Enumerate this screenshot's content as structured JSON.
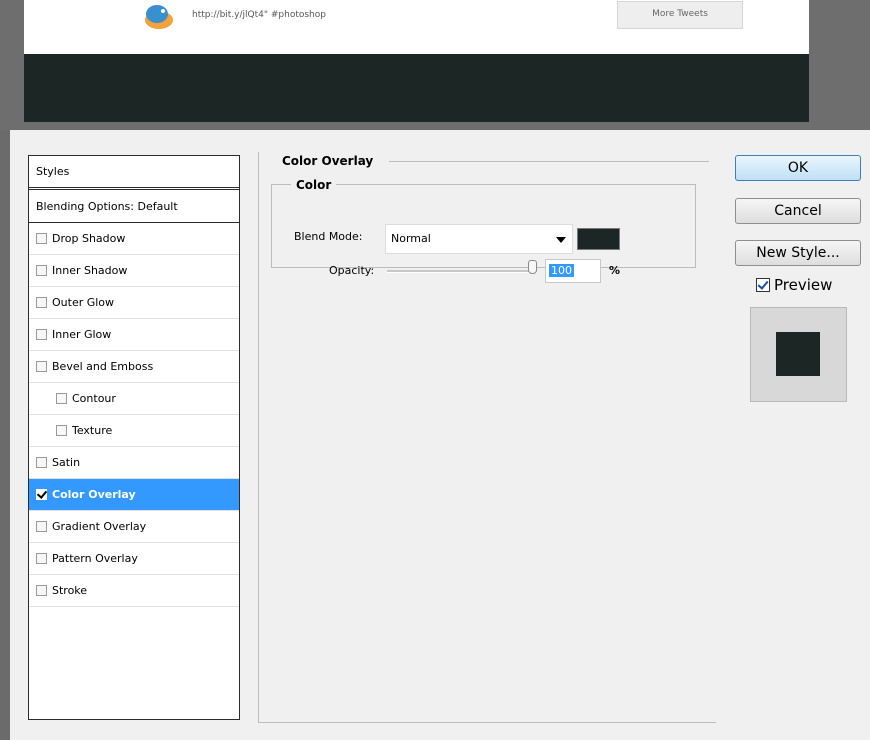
{
  "background": {
    "tweet_text": "http://bit.y/jlQt4\" #photoshop",
    "more_tweets_label": "More Tweets"
  },
  "styles_panel": {
    "header": "Styles",
    "blending_options": "Blending Options: Default",
    "items": [
      {
        "label": "Drop Shadow",
        "checked": false,
        "indent": false,
        "selected": false
      },
      {
        "label": "Inner Shadow",
        "checked": false,
        "indent": false,
        "selected": false
      },
      {
        "label": "Outer Glow",
        "checked": false,
        "indent": false,
        "selected": false
      },
      {
        "label": "Inner Glow",
        "checked": false,
        "indent": false,
        "selected": false
      },
      {
        "label": "Bevel and Emboss",
        "checked": false,
        "indent": false,
        "selected": false
      },
      {
        "label": "Contour",
        "checked": false,
        "indent": true,
        "selected": false
      },
      {
        "label": "Texture",
        "checked": false,
        "indent": true,
        "selected": false
      },
      {
        "label": "Satin",
        "checked": false,
        "indent": false,
        "selected": false
      },
      {
        "label": "Color Overlay",
        "checked": true,
        "indent": false,
        "selected": true
      },
      {
        "label": "Gradient Overlay",
        "checked": false,
        "indent": false,
        "selected": false
      },
      {
        "label": "Pattern Overlay",
        "checked": false,
        "indent": false,
        "selected": false
      },
      {
        "label": "Stroke",
        "checked": false,
        "indent": false,
        "selected": false
      }
    ]
  },
  "color_overlay": {
    "group_title": "Color Overlay",
    "color_group_title": "Color",
    "blend_mode_label": "Blend Mode:",
    "blend_mode_value": "Normal",
    "overlay_color": "#1c2624",
    "opacity_label": "Opacity:",
    "opacity_value": "100",
    "opacity_unit": "%",
    "opacity_fraction": 1.0
  },
  "buttons": {
    "ok": "OK",
    "cancel": "Cancel",
    "new_style": "New Style..."
  },
  "preview": {
    "label": "Preview",
    "checked": true
  },
  "colors": {
    "selection": "#3399ff",
    "dialog_bg": "#f0f0f0",
    "canvas_dark": "#1c2624"
  }
}
